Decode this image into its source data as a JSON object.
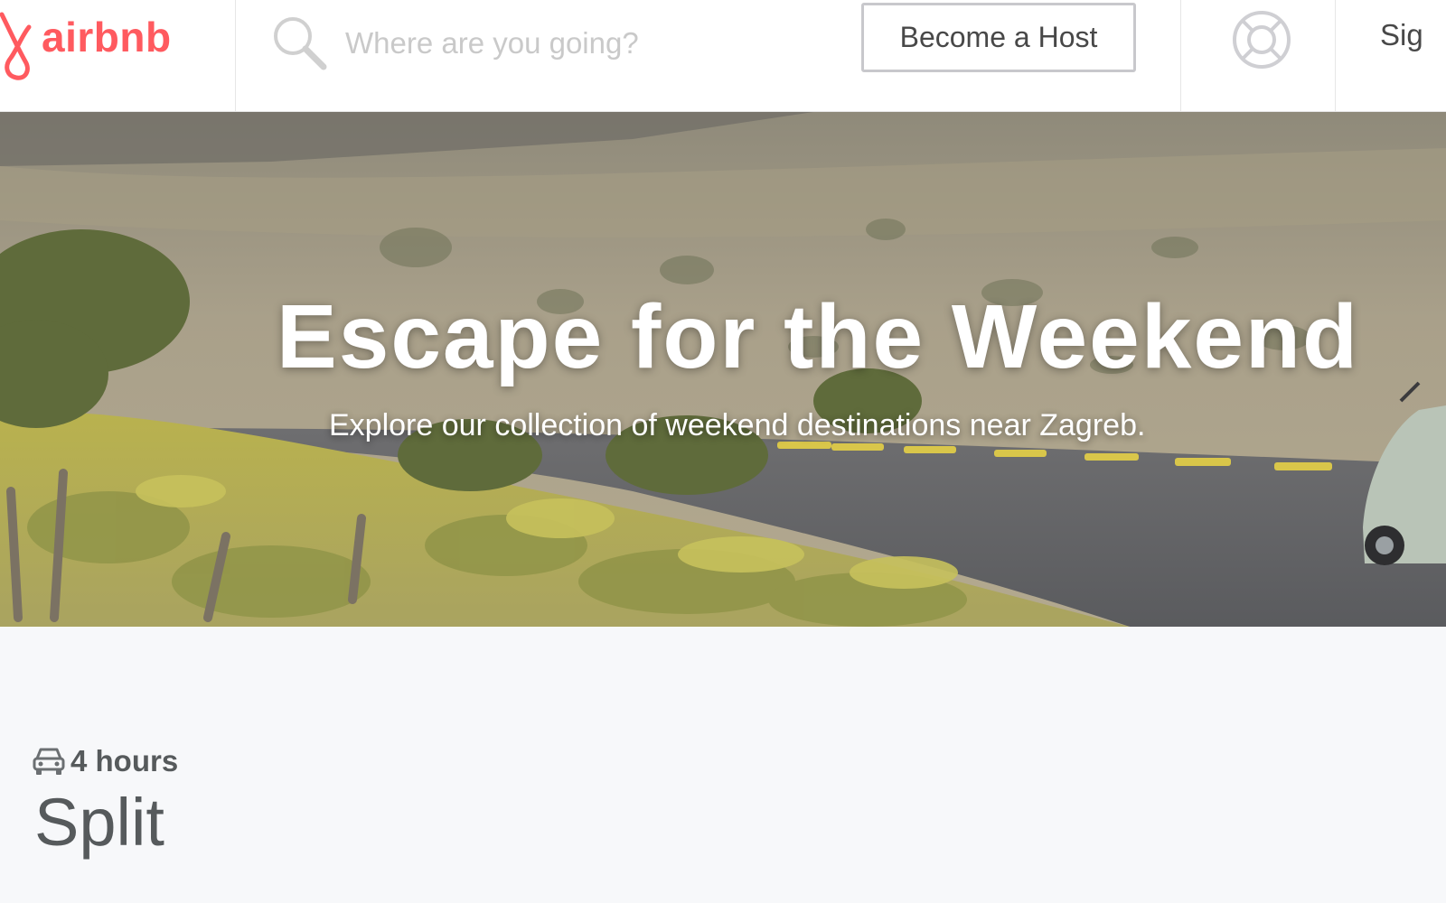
{
  "header": {
    "brand_name": "airbnb",
    "search_placeholder": "Where are you going?",
    "become_host_label": "Become a Host",
    "sign_in_label": "Sig"
  },
  "hero": {
    "title": "Escape for the Weekend",
    "subtitle": "Explore our collection of weekend destinations near Zagreb."
  },
  "destination": {
    "duration": "4 hours",
    "name": "Split"
  },
  "icons": {
    "logo": "airbnb-belo-logo",
    "search": "search-icon",
    "help": "lifebuoy-help-icon",
    "duration": "car-icon"
  },
  "colors": {
    "brand": "#ff5a5f",
    "text": "#484848",
    "placeholder": "#c9c9c9",
    "content_bg": "#f7f8fa"
  }
}
